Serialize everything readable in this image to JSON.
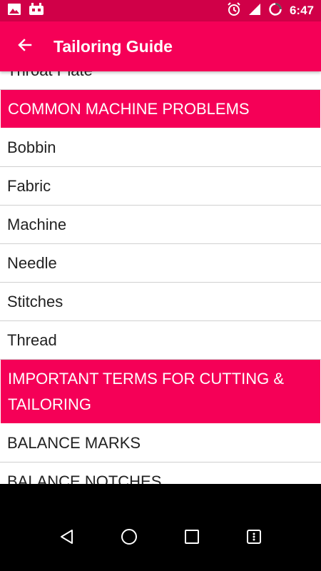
{
  "status_bar": {
    "time": "6:47",
    "icons": [
      "image-icon",
      "android-debug-icon",
      "alarm-icon",
      "signal-icon",
      "sync-icon"
    ]
  },
  "app_bar": {
    "title": "Tailoring Guide",
    "back_icon": "arrow-back-icon"
  },
  "list": {
    "partial_top_item": "Throat Plate",
    "sections": [
      {
        "header": "COMMON MACHINE PROBLEMS",
        "items": [
          "Bobbin",
          "Fabric",
          "Machine",
          "Needle",
          "Stitches",
          "Thread"
        ]
      },
      {
        "header": "IMPORTANT TERMS FOR CUTTING & TAILORING",
        "items": [
          "BALANCE MARKS",
          "BALANCE NOTCHES"
        ]
      }
    ]
  },
  "nav_bar": {
    "icons": [
      "back-triangle-icon",
      "home-circle-icon",
      "recents-square-icon",
      "menu-icon"
    ]
  },
  "colors": {
    "accent": "#f50057",
    "status_bar": "#d00048"
  }
}
